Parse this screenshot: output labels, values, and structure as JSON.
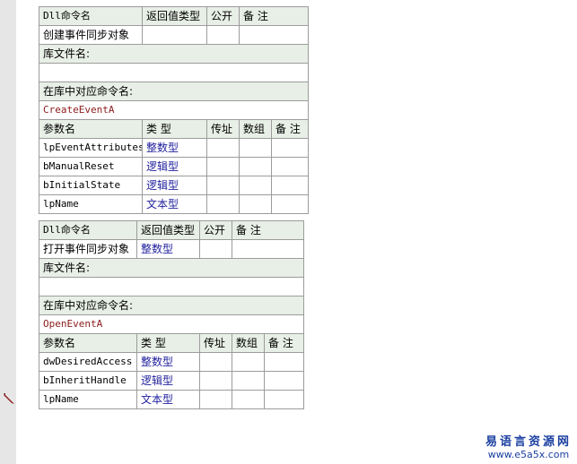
{
  "tables": [
    {
      "header": [
        "Dll命令名",
        "返回值类型",
        "公开",
        "备 注"
      ],
      "row": [
        "创建事件同步对象",
        "",
        "",
        ""
      ],
      "lib_label": "库文件名:",
      "lib_value": "",
      "cmd_label": "在库中对应命令名:",
      "cmd_value": "CreateEventA",
      "param_header": [
        "参数名",
        "类 型",
        "传址",
        "数组",
        "备 注"
      ],
      "params": [
        [
          "lpEventAttributes",
          "整数型",
          "",
          "",
          ""
        ],
        [
          "bManualReset",
          "逻辑型",
          "",
          "",
          ""
        ],
        [
          "bInitialState",
          "逻辑型",
          "",
          "",
          ""
        ],
        [
          "lpName",
          "文本型",
          "",
          "",
          ""
        ]
      ]
    },
    {
      "header": [
        "Dll命令名",
        "返回值类型",
        "公开",
        "备 注"
      ],
      "row": [
        "打开事件同步对象",
        "整数型",
        "",
        ""
      ],
      "lib_label": "库文件名:",
      "lib_value": "",
      "cmd_label": "在库中对应命令名:",
      "cmd_value": "OpenEventA",
      "param_header": [
        "参数名",
        "类 型",
        "传址",
        "数组",
        "备 注"
      ],
      "params": [
        [
          "dwDesiredAccess",
          "整数型",
          "",
          "",
          ""
        ],
        [
          "bInheritHandle",
          "逻辑型",
          "",
          "",
          ""
        ],
        [
          "lpName",
          "文本型",
          "",
          "",
          ""
        ]
      ]
    }
  ],
  "watermark": {
    "name": "易语言资源网",
    "url": "www.e5a5x.com"
  }
}
